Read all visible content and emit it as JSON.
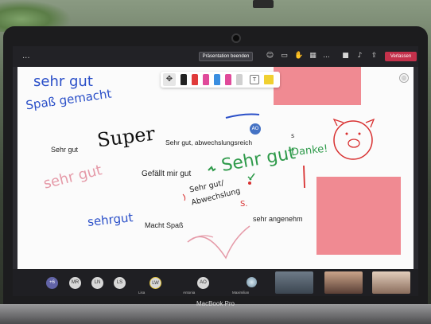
{
  "toolbar": {
    "stop_presentation_label": "Präsentation beenden",
    "leave_label": "Verlassen",
    "more_label": "...",
    "icons": [
      "people-icon",
      "chat-icon",
      "raise-hand-icon",
      "breakout-icon",
      "more-icon",
      "camera-icon",
      "mic-icon",
      "share-icon"
    ]
  },
  "whiteboard": {
    "pens": [
      "#222222",
      "#e03a3a",
      "#e04a9a",
      "#3a8ee0",
      "#e04a9a",
      "#e8e8e8",
      "#f0d030"
    ],
    "handwritten": {
      "sehr_gut_top": "sehr gut",
      "spass_gemacht": "Spaß gemacht",
      "super": "Super",
      "sehr_gut_pink": "sehr gut",
      "sehrgut_blue": "sehrgut",
      "sehr_gut_green": "Sehr gut",
      "danke": "Danke!",
      "sehr_gut_abw_1": "Sehr gut/",
      "sehr_gut_abw_2": "Abwechslung",
      "s_red": "S.",
      "s_small": "s"
    },
    "typed": {
      "sehr_gut": "Sehr gut",
      "sehr_gut_abwechslungsreich": "Sehr gut, abwechslungsreich",
      "gefaellt_mir_gut": "Gefällt mir gut",
      "macht_spass": "Macht Spaß",
      "sehr_angenehm": "sehr angenehm"
    },
    "cursor_avatar": "AO",
    "note_color": "#f08a92"
  },
  "participants": {
    "overflow": "+6",
    "avatars": [
      "MR",
      "LN",
      "LS",
      "LW",
      "AO"
    ],
    "names": [
      "Lisa",
      "Antonia",
      "Maximilian"
    ]
  },
  "device": {
    "label": "MacBook Pro"
  }
}
